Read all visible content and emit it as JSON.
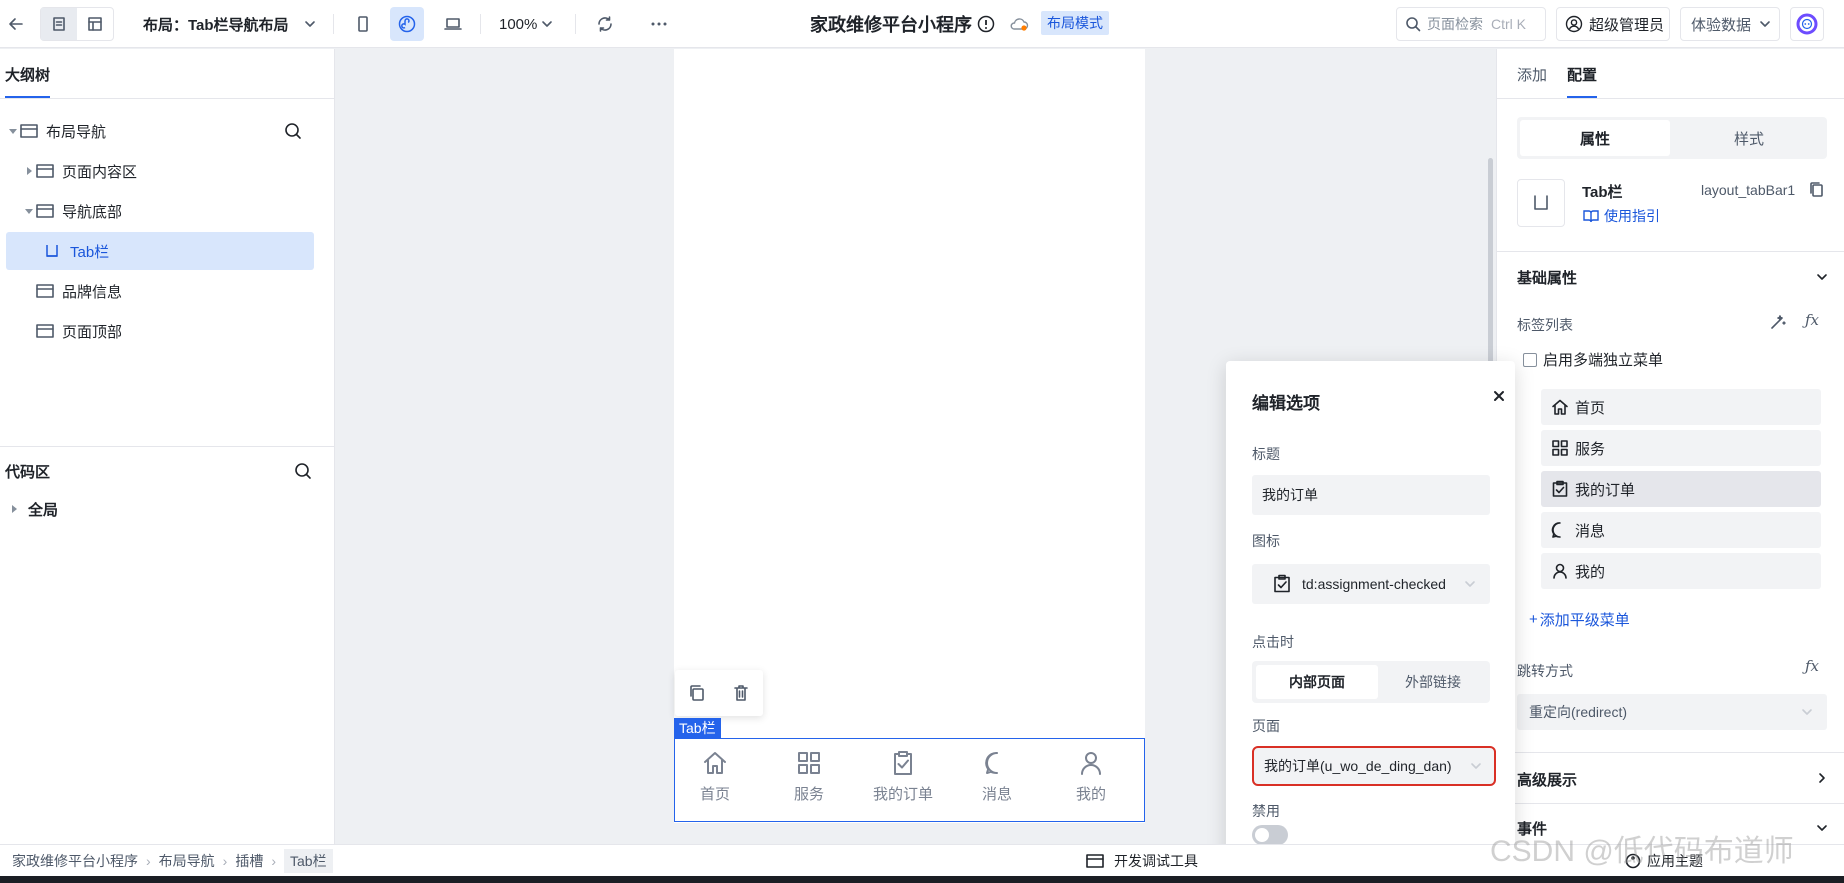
{
  "topbar": {
    "layout_label": "布局：Tab栏导航布局",
    "zoom": "100%",
    "app_title": "家政维修平台小程序",
    "mode_badge": "布局模式",
    "search_placeholder": "页面检索",
    "search_shortcut": "Ctrl K",
    "user": "超级管理员",
    "data_mode": "体验数据"
  },
  "outline": {
    "title": "大纲树",
    "items": [
      {
        "label": "布局导航"
      },
      {
        "label": "页面内容区"
      },
      {
        "label": "导航底部"
      },
      {
        "label": "Tab栏"
      },
      {
        "label": "品牌信息"
      },
      {
        "label": "页面顶部"
      }
    ]
  },
  "code_area": {
    "title": "代码区",
    "global": "全局"
  },
  "canvas": {
    "selection_label": "Tab栏",
    "tabs": [
      {
        "label": "首页",
        "icon": "home-icon"
      },
      {
        "label": "服务",
        "icon": "grid-icon"
      },
      {
        "label": "我的订单",
        "icon": "assignment-checked-icon"
      },
      {
        "label": "消息",
        "icon": "chat-icon"
      },
      {
        "label": "我的",
        "icon": "user-icon"
      }
    ]
  },
  "right_panel": {
    "tabs": [
      "添加",
      "配置"
    ],
    "segments": [
      "属性",
      "样式"
    ],
    "component_name": "Tab栏",
    "component_id": "layout_tabBar1",
    "guide_link": "使用指引",
    "section_basic": "基础属性",
    "tag_list_label": "标签列表",
    "multi_menu_label": "启用多端独立菜单",
    "menu_items": [
      "首页",
      "服务",
      "我的订单",
      "消息",
      "我的"
    ],
    "add_menu": "添加平级菜单",
    "nav_mode_label": "跳转方式",
    "nav_mode_value": "重定向(redirect)",
    "section_advanced": "高级展示",
    "section_other": "事件"
  },
  "popup": {
    "title": "编辑选项",
    "title_label": "标题",
    "title_value": "我的订单",
    "icon_label": "图标",
    "icon_value": "td:assignment-checked",
    "click_label": "点击时",
    "click_options": [
      "内部页面",
      "外部链接"
    ],
    "page_label": "页面",
    "page_value": "我的订单(u_wo_de_ding_dan)",
    "disabled_label": "禁用"
  },
  "bottom": {
    "breadcrumb": [
      "家政维修平台小程序",
      "布局导航",
      "插槽",
      "Tab栏"
    ],
    "devtools": "开发调试工具",
    "apply_theme": "应用主题",
    "watermark": "CSDN @低代码布道师"
  },
  "colors": {
    "accent": "#2463eb",
    "danger": "#d93025"
  }
}
